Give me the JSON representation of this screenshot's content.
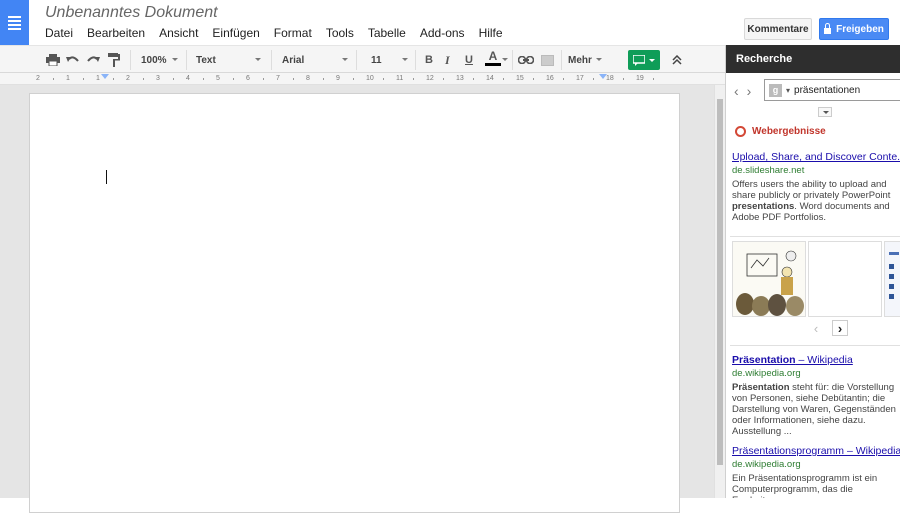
{
  "app": {
    "doc_title": "Unbenanntes Dokument",
    "menu": [
      "Datei",
      "Bearbeiten",
      "Ansicht",
      "Einfügen",
      "Format",
      "Tools",
      "Tabelle",
      "Add-ons",
      "Hilfe"
    ],
    "comment_button": "Kommentare",
    "share_button": "Freigeben"
  },
  "toolbar": {
    "zoom": "100%",
    "style": "Text",
    "font": "Arial",
    "size": "11",
    "bold": "B",
    "italic": "I",
    "underline": "U",
    "text_color": "A",
    "more": "Mehr"
  },
  "ruler": {
    "ticks": [
      "2",
      "1",
      "1",
      "2",
      "3",
      "4",
      "5",
      "6",
      "7",
      "8",
      "9",
      "10",
      "11",
      "12",
      "13",
      "14",
      "15",
      "16",
      "17",
      "18",
      "19"
    ]
  },
  "research": {
    "title": "Recherche",
    "query": "präsentationen",
    "section": "Webergebnisse",
    "results": [
      {
        "title": "Upload, Share, and Discover Conte...",
        "url": "de.slideshare.net",
        "desc_pre": "Offers users the ability to upload and share publicly or privately PowerPoint ",
        "desc_bold": "presentations",
        "desc_post": ". Word documents and Adobe PDF Portfolios."
      },
      {
        "title": "Präsentation – Wikipedia",
        "url": "de.wikipedia.org",
        "desc_pre": "",
        "desc_bold": "Präsentation",
        "desc_post": " steht für: die Vorstellung von Personen, siehe Debütantin; die Darstellung von Waren, Gegenständen oder Informationen, siehe dazu. Ausstellung ..."
      },
      {
        "title": "Präsentationsprogramm – Wikipedia",
        "url": "de.wikipedia.org",
        "desc_pre": "",
        "desc_bold": "",
        "desc_post": "Ein Präsentationsprogramm ist ein Computerprogramm, das die Erarbeitung"
      }
    ]
  },
  "colors": {
    "brand_blue": "#4285f4",
    "share_blue": "#4a8af4",
    "panel_header": "#2e2e2e",
    "link": "#1a0dab",
    "url_green": "#2e7d32",
    "web_red": "#c1352b",
    "comment_green": "#0f9d58"
  }
}
